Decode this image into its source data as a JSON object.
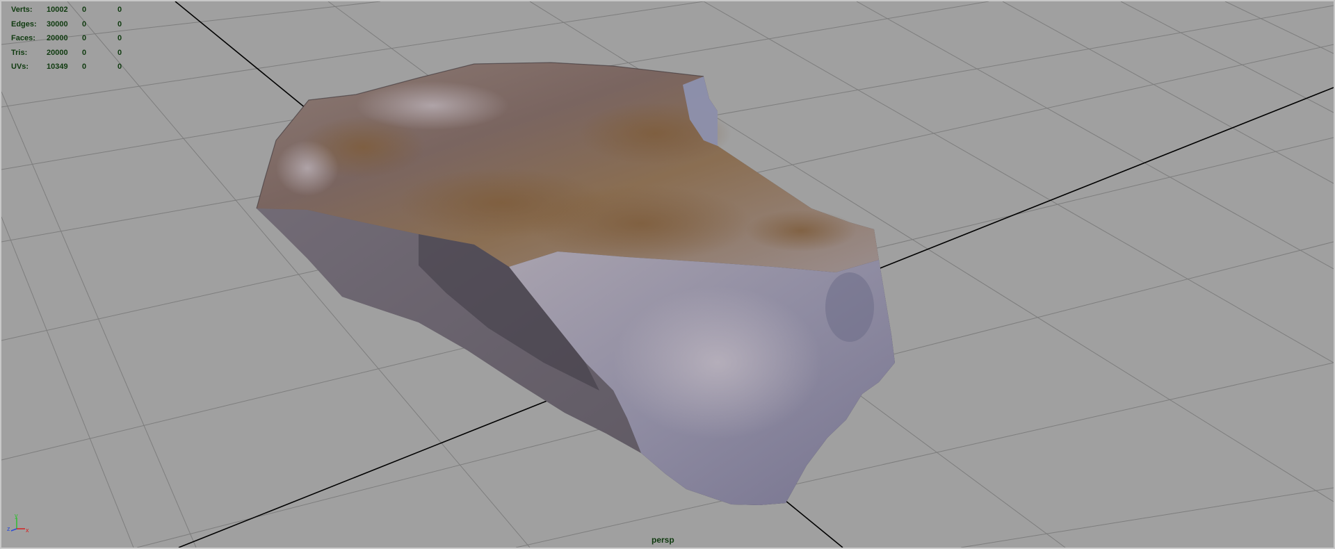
{
  "hud": {
    "rows": [
      {
        "label": "Verts:",
        "v1": "10002",
        "v2": "0",
        "v3": "0"
      },
      {
        "label": "Edges:",
        "v1": "30000",
        "v2": "0",
        "v3": "0"
      },
      {
        "label": "Faces:",
        "v1": "20000",
        "v2": "0",
        "v3": "0"
      },
      {
        "label": "Tris:",
        "v1": "20000",
        "v2": "0",
        "v3": "0"
      },
      {
        "label": "UVs:",
        "v1": "10349",
        "v2": "0",
        "v3": "0"
      }
    ]
  },
  "camera": {
    "name": "persp"
  },
  "axis": {
    "x_label": "x",
    "y_label": "y",
    "z_label": "z"
  },
  "colors": {
    "viewport_bg": "#a0a0a0",
    "grid_line": "#7d7d7d",
    "axis_line": "#000000",
    "hud_text": "#0f3a0f"
  }
}
